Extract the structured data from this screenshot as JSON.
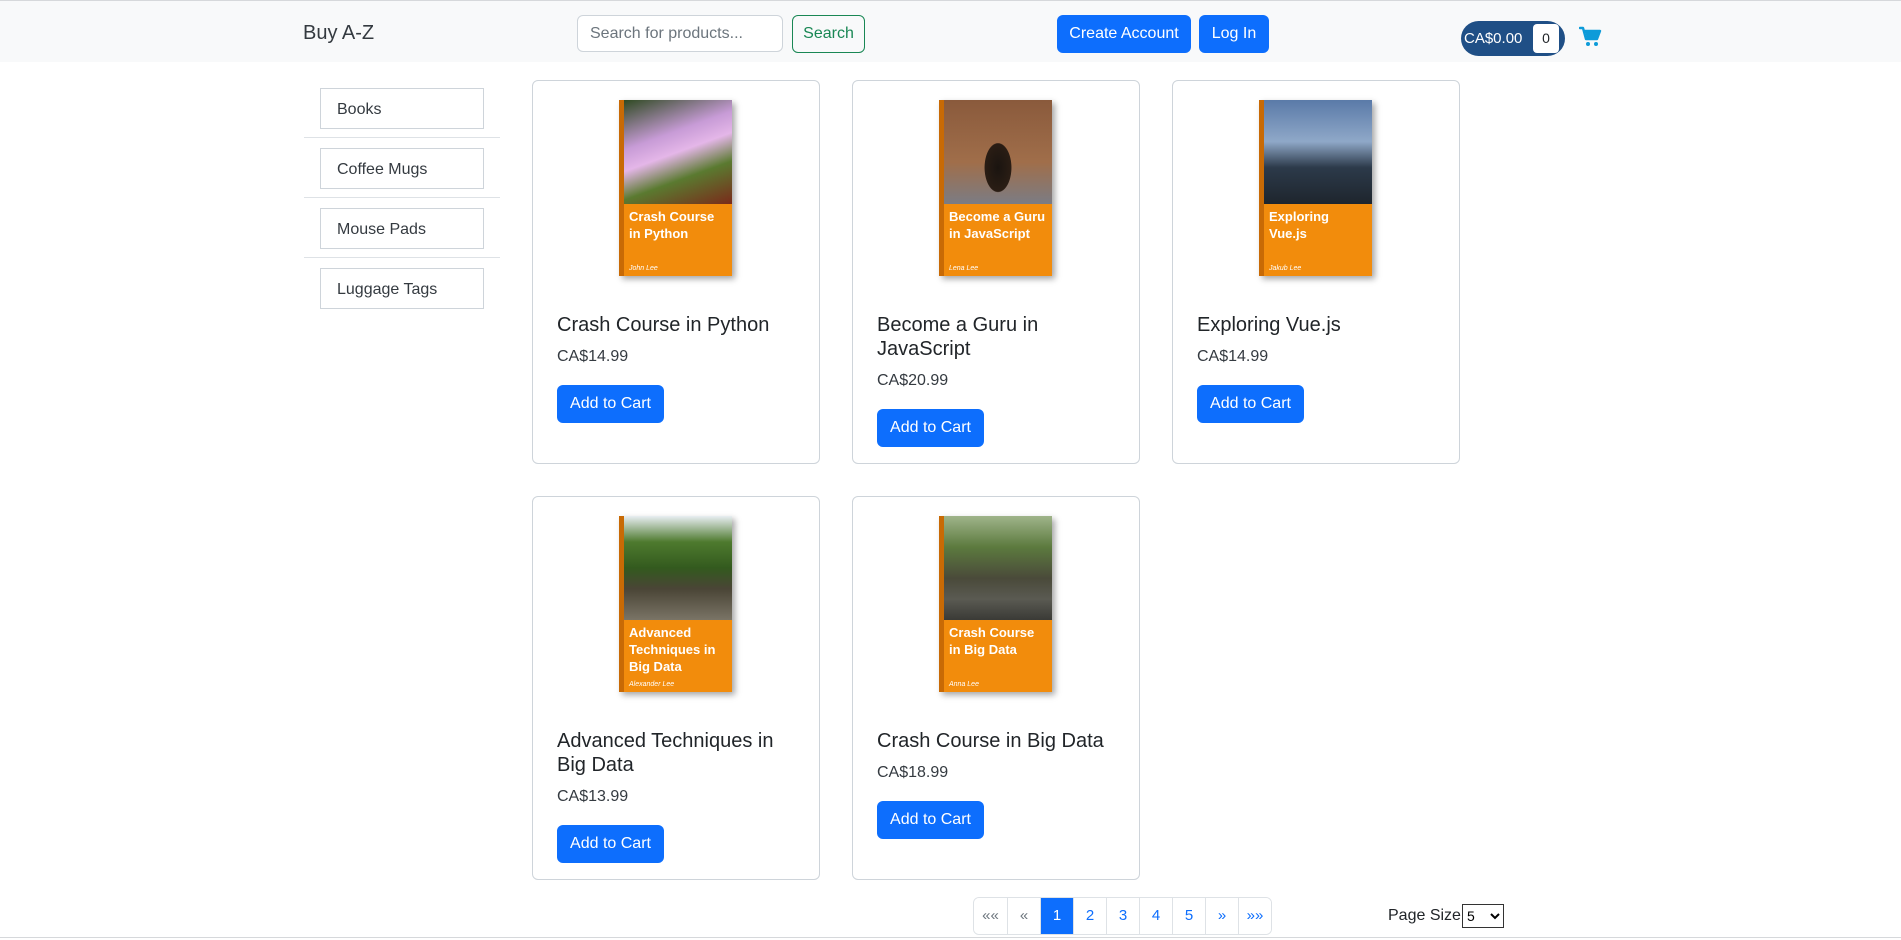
{
  "header": {
    "brand": "Buy A-Z",
    "search_placeholder": "Search for products...",
    "search_label": "Search",
    "create_account_label": "Create Account",
    "login_label": "Log In",
    "cart_total": "CA$0.00",
    "cart_count": "0",
    "cart_icon": "shopping-cart-icon"
  },
  "sidebar": {
    "categories": [
      {
        "label": "Books"
      },
      {
        "label": "Coffee Mugs"
      },
      {
        "label": "Mouse Pads"
      },
      {
        "label": "Luggage Tags"
      }
    ]
  },
  "products": [
    {
      "name": "Crash Course in Python",
      "price": "CA$14.99",
      "cover_title": "Crash Course in Python",
      "cover_author": "John Lee",
      "button": "Add to Cart"
    },
    {
      "name": "Become a Guru in JavaScript",
      "price": "CA$20.99",
      "cover_title": "Become a Guru in JavaScript",
      "cover_author": "Lena Lee",
      "button": "Add to Cart"
    },
    {
      "name": "Exploring Vue.js",
      "price": "CA$14.99",
      "cover_title": "Exploring Vue.js",
      "cover_author": "Jakub Lee",
      "button": "Add to Cart"
    },
    {
      "name": "Advanced Techniques in Big Data",
      "price": "CA$13.99",
      "cover_title": "Advanced Techniques in Big Data",
      "cover_author": "Alexander Lee",
      "button": "Add to Cart"
    },
    {
      "name": "Crash Course in Big Data",
      "price": "CA$18.99",
      "cover_title": "Crash Course in Big Data",
      "cover_author": "Anna Lee",
      "button": "Add to Cart"
    }
  ],
  "pagination": {
    "first": "««",
    "prev": "«",
    "pages": [
      "1",
      "2",
      "3",
      "4",
      "5"
    ],
    "active_page": "1",
    "next": "»",
    "last": "»»"
  },
  "page_size": {
    "label": "Page Size:",
    "selected": "5"
  },
  "colors": {
    "primary": "#0d6efd",
    "success": "#198754",
    "cover_orange": "#f28c0c",
    "cart_pill": "#1f4f86"
  }
}
